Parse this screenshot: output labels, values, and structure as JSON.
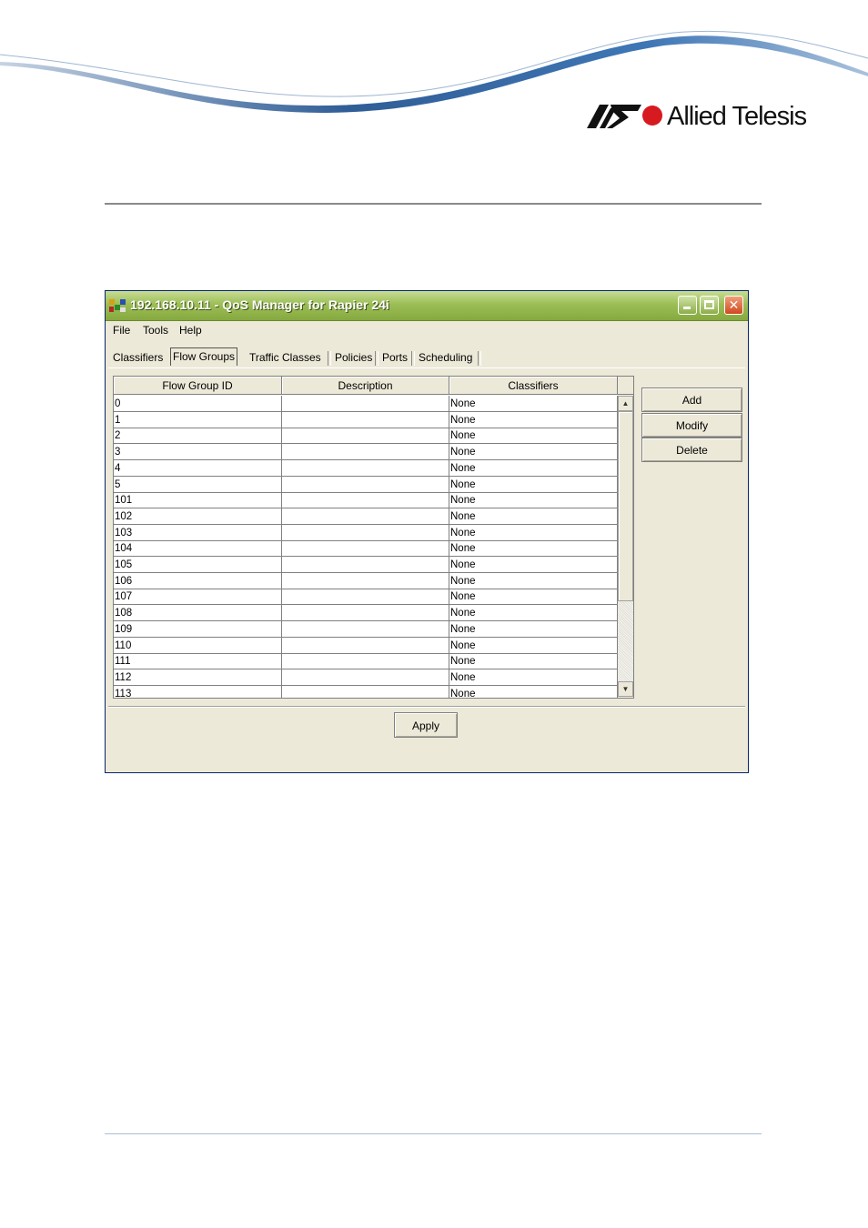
{
  "header": {
    "brand": "Allied Telesis",
    "brand_color": "#d71920"
  },
  "window": {
    "title": "192.168.10.11 - QoS Manager for Rapier 24i",
    "icons": [
      "app-icon",
      "minimize-icon",
      "maximize-icon",
      "close-icon"
    ]
  },
  "menu": {
    "file": "File",
    "tools": "Tools",
    "help": "Help"
  },
  "tabs": {
    "classifiers": "Classifiers",
    "flow_groups": "Flow Groups",
    "traffic_classes": "Traffic Classes",
    "policies": "Policies",
    "ports": "Ports",
    "scheduling": "Scheduling",
    "active": "Flow Groups"
  },
  "table": {
    "columns": [
      "Flow Group ID",
      "Description",
      "Classifiers"
    ],
    "rows": [
      [
        "0",
        "",
        "None"
      ],
      [
        "1",
        "",
        "None"
      ],
      [
        "2",
        "",
        "None"
      ],
      [
        "3",
        "",
        "None"
      ],
      [
        "4",
        "",
        "None"
      ],
      [
        "5",
        "",
        "None"
      ],
      [
        "101",
        "",
        "None"
      ],
      [
        "102",
        "",
        "None"
      ],
      [
        "103",
        "",
        "None"
      ],
      [
        "104",
        "",
        "None"
      ],
      [
        "105",
        "",
        "None"
      ],
      [
        "106",
        "",
        "None"
      ],
      [
        "107",
        "",
        "None"
      ],
      [
        "108",
        "",
        "None"
      ],
      [
        "109",
        "",
        "None"
      ],
      [
        "110",
        "",
        "None"
      ],
      [
        "111",
        "",
        "None"
      ],
      [
        "112",
        "",
        "None"
      ],
      [
        "113",
        "",
        "None"
      ]
    ]
  },
  "buttons": {
    "add": "Add",
    "modify": "Modify",
    "delete": "Delete",
    "apply": "Apply"
  }
}
